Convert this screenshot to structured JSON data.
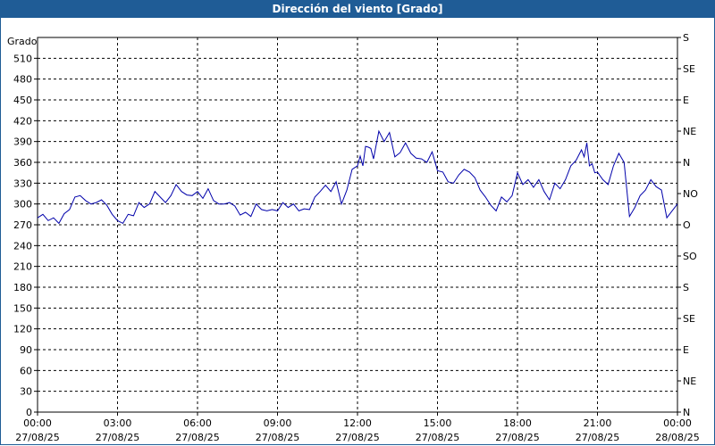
{
  "window": {
    "title": "Dirección del viento [Grado]"
  },
  "chart_data": {
    "type": "line",
    "title": "Dirección del viento [Grado]",
    "ylabel": "Grado",
    "ylim": [
      0,
      540
    ],
    "y_ticks": [
      0,
      30,
      60,
      90,
      120,
      150,
      180,
      210,
      240,
      270,
      300,
      330,
      360,
      390,
      420,
      450,
      480,
      510
    ],
    "right_axis_labels": [
      {
        "value": 0,
        "label": "N"
      },
      {
        "value": 45,
        "label": "NE"
      },
      {
        "value": 90,
        "label": "E"
      },
      {
        "value": 135,
        "label": "SE"
      },
      {
        "value": 180,
        "label": "S"
      },
      {
        "value": 225,
        "label": "SO"
      },
      {
        "value": 270,
        "label": "O"
      },
      {
        "value": 315,
        "label": "NO"
      },
      {
        "value": 360,
        "label": "N"
      },
      {
        "value": 405,
        "label": "NE"
      },
      {
        "value": 450,
        "label": "E"
      },
      {
        "value": 495,
        "label": "SE"
      },
      {
        "value": 540,
        "label": "S"
      }
    ],
    "x_ticks": [
      {
        "time": "00:00",
        "date": "27/08/25"
      },
      {
        "time": "03:00",
        "date": "27/08/25"
      },
      {
        "time": "06:00",
        "date": "27/08/25"
      },
      {
        "time": "09:00",
        "date": "27/08/25"
      },
      {
        "time": "12:00",
        "date": "27/08/25"
      },
      {
        "time": "15:00",
        "date": "27/08/25"
      },
      {
        "time": "18:00",
        "date": "27/08/25"
      },
      {
        "time": "21:00",
        "date": "27/08/25"
      },
      {
        "time": "00:00",
        "date": "28/08/25"
      }
    ],
    "grid": true,
    "series": [
      {
        "color": "#0000aa",
        "x_hours": [
          0.0,
          0.2,
          0.4,
          0.6,
          0.8,
          1.0,
          1.2,
          1.4,
          1.6,
          1.8,
          2.0,
          2.2,
          2.4,
          2.6,
          2.8,
          3.0,
          3.2,
          3.4,
          3.6,
          3.8,
          4.0,
          4.2,
          4.4,
          4.6,
          4.8,
          5.0,
          5.2,
          5.4,
          5.6,
          5.8,
          6.0,
          6.2,
          6.4,
          6.6,
          6.8,
          7.0,
          7.2,
          7.4,
          7.6,
          7.8,
          8.0,
          8.2,
          8.4,
          8.6,
          8.8,
          9.0,
          9.2,
          9.4,
          9.6,
          9.8,
          10.0,
          10.2,
          10.4,
          10.6,
          10.8,
          11.0,
          11.2,
          11.4,
          11.6,
          11.8,
          12.0,
          12.1,
          12.2,
          12.3,
          12.4,
          12.5,
          12.6,
          12.8,
          13.0,
          13.2,
          13.4,
          13.6,
          13.8,
          14.0,
          14.2,
          14.4,
          14.6,
          14.8,
          15.0,
          15.2,
          15.4,
          15.6,
          15.8,
          16.0,
          16.2,
          16.4,
          16.6,
          16.8,
          17.0,
          17.2,
          17.4,
          17.6,
          17.8,
          18.0,
          18.2,
          18.4,
          18.6,
          18.8,
          19.0,
          19.2,
          19.4,
          19.6,
          19.8,
          20.0,
          20.2,
          20.4,
          20.5,
          20.6,
          20.7,
          20.8,
          20.9,
          21.0,
          21.2,
          21.4,
          21.6,
          21.8,
          22.0,
          22.2,
          22.4,
          22.6,
          22.8,
          23.0,
          23.2,
          23.4,
          23.6,
          23.8,
          24.0
        ],
        "values": [
          280,
          285,
          276,
          280,
          272,
          286,
          292,
          310,
          312,
          305,
          300,
          302,
          306,
          298,
          285,
          276,
          272,
          285,
          283,
          302,
          295,
          300,
          318,
          310,
          302,
          312,
          328,
          318,
          313,
          312,
          318,
          308,
          322,
          305,
          300,
          300,
          302,
          297,
          284,
          288,
          282,
          300,
          292,
          290,
          292,
          290,
          302,
          295,
          300,
          290,
          293,
          292,
          310,
          318,
          327,
          318,
          332,
          300,
          320,
          350,
          355,
          369,
          355,
          383,
          382,
          380,
          365,
          405,
          390,
          403,
          368,
          374,
          388,
          373,
          366,
          365,
          360,
          375,
          348,
          346,
          332,
          330,
          342,
          350,
          346,
          338,
          320,
          310,
          298,
          290,
          310,
          303,
          312,
          345,
          328,
          335,
          324,
          335,
          318,
          306,
          330,
          322,
          335,
          355,
          363,
          378,
          368,
          388,
          355,
          358,
          345,
          346,
          335,
          328,
          355,
          373,
          360,
          282,
          295,
          312,
          320,
          335,
          325,
          320,
          280,
          290,
          300,
          310
        ]
      }
    ]
  }
}
